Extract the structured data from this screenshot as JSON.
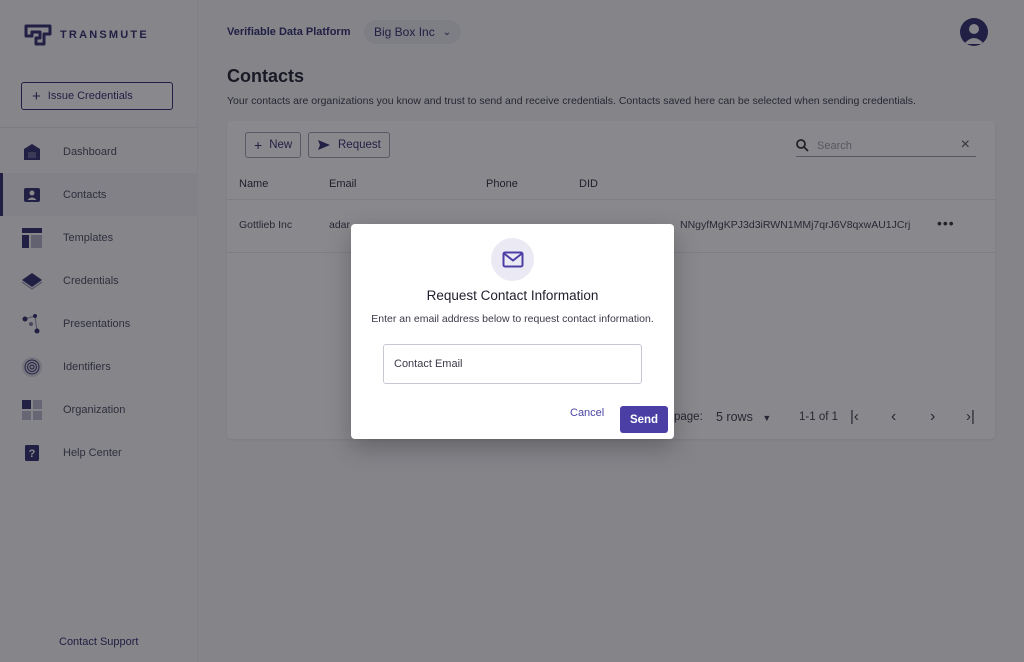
{
  "brand": {
    "name": "TRANSMUTE",
    "accent": "#2f2a6b",
    "button": "#4b3fa6"
  },
  "sidebar": {
    "issue_label": "Issue Credentials",
    "items": [
      {
        "label": "Dashboard",
        "icon": "house-icon"
      },
      {
        "label": "Contacts",
        "icon": "contact-card-icon",
        "active": true
      },
      {
        "label": "Templates",
        "icon": "template-icon"
      },
      {
        "label": "Credentials",
        "icon": "diamond-icon"
      },
      {
        "label": "Presentations",
        "icon": "network-icon"
      },
      {
        "label": "Identifiers",
        "icon": "fingerprint-icon"
      },
      {
        "label": "Organization",
        "icon": "grid-icon"
      },
      {
        "label": "Help Center",
        "icon": "question-icon"
      }
    ],
    "support_label": "Contact Support"
  },
  "header": {
    "platform": "Verifiable Data Platform",
    "org": "Big Box Inc"
  },
  "main": {
    "title": "Contacts",
    "description": "Your contacts are organizations you know and trust to send and receive credentials. Contacts saved here can be selected when sending credentials.",
    "toolbar": {
      "new_label": "New",
      "request_label": "Request",
      "search_placeholder": "Search"
    },
    "columns": [
      "Name",
      "Email",
      "Phone",
      "DID"
    ],
    "rows": [
      {
        "name": "Gottlieb Inc",
        "email": "adar",
        "did": "NNgyfMgKPJ3d3iRWN1MMj7qrJ6V8qxwAU1JCrj"
      }
    ],
    "pagination": {
      "rows_label": "page:",
      "rows_value": "5 rows",
      "range": "1-1 of 1"
    }
  },
  "dialog": {
    "icon": "mail-icon",
    "title": "Request Contact Information",
    "subtitle": "Enter an email address below to request contact information.",
    "input_placeholder": "Contact Email",
    "cancel_label": "Cancel",
    "send_label": "Send"
  }
}
